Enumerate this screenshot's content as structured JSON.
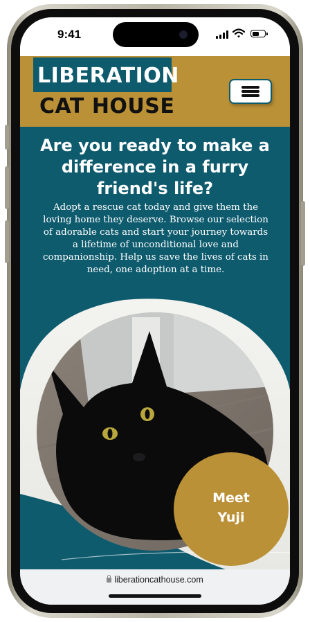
{
  "device": {
    "time": "9:41"
  },
  "header": {
    "logo_line1": "LIBERATION",
    "logo_line2": "CAT HOUSE",
    "menu_icon": "hamburger-menu-icon"
  },
  "hero": {
    "headline": "Are you ready to make a difference in a furry friend's life?",
    "body": "Adopt a rescue cat today and give them the loving home they deserve. Browse our selection of adorable cats and start your journey towards a lifetime of unconditional love and companionship. Help us save the lives of cats in need, one adoption at a time.",
    "cta_label": "Meet\nYuji"
  },
  "browser": {
    "url": "liberationcathouse.com"
  },
  "colors": {
    "brand_gold": "#bb9137",
    "brand_teal": "#0e5b6e"
  }
}
